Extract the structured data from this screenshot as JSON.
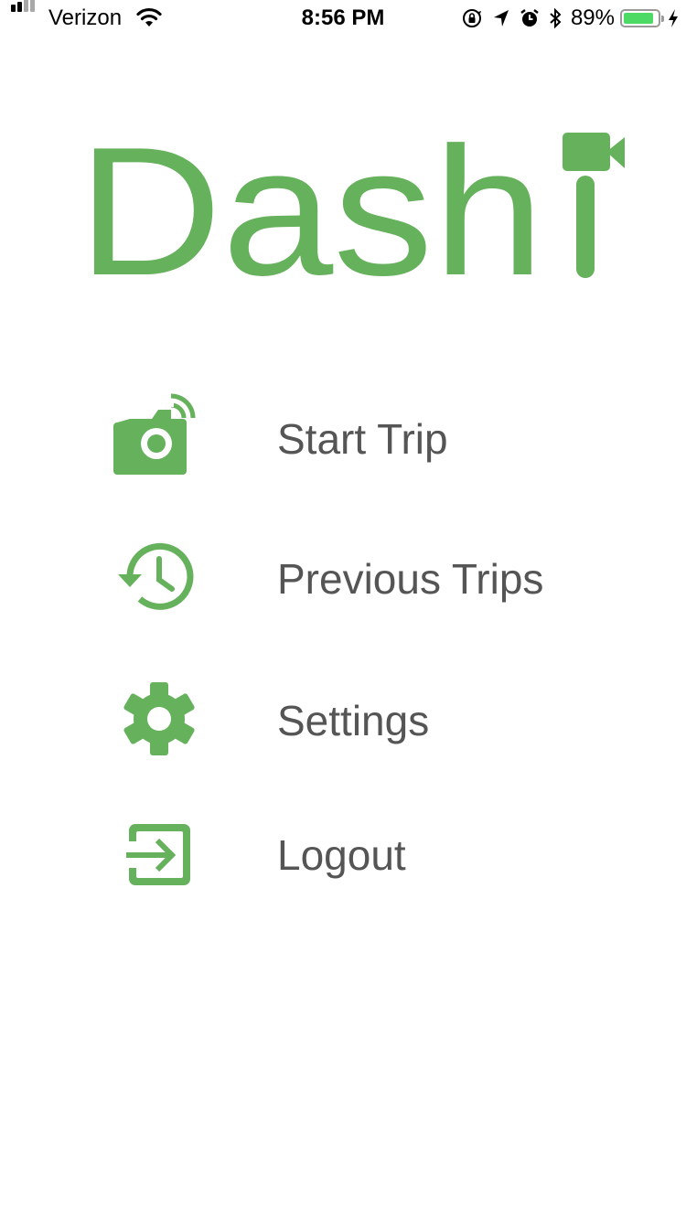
{
  "status_bar": {
    "carrier": "Verizon",
    "time": "8:56 PM",
    "battery_percent": "89%",
    "battery_level": 0.89,
    "icons": [
      "signal-icon",
      "wifi-icon",
      "orientation-lock-icon",
      "location-arrow-icon",
      "alarm-icon",
      "bluetooth-icon",
      "battery-icon",
      "charging-bolt-icon"
    ]
  },
  "logo": {
    "text": "Dash",
    "icon": "video-camera-icon"
  },
  "menu": {
    "items": [
      {
        "label": "Start Trip",
        "icon": "camera-broadcast-icon"
      },
      {
        "label": "Previous Trips",
        "icon": "history-clock-icon"
      },
      {
        "label": "Settings",
        "icon": "gear-icon"
      },
      {
        "label": "Logout",
        "icon": "exit-arrow-icon"
      }
    ]
  },
  "colors": {
    "brand_green": "#66b15c",
    "label_gray": "#555555",
    "battery_green": "#4cd964"
  }
}
